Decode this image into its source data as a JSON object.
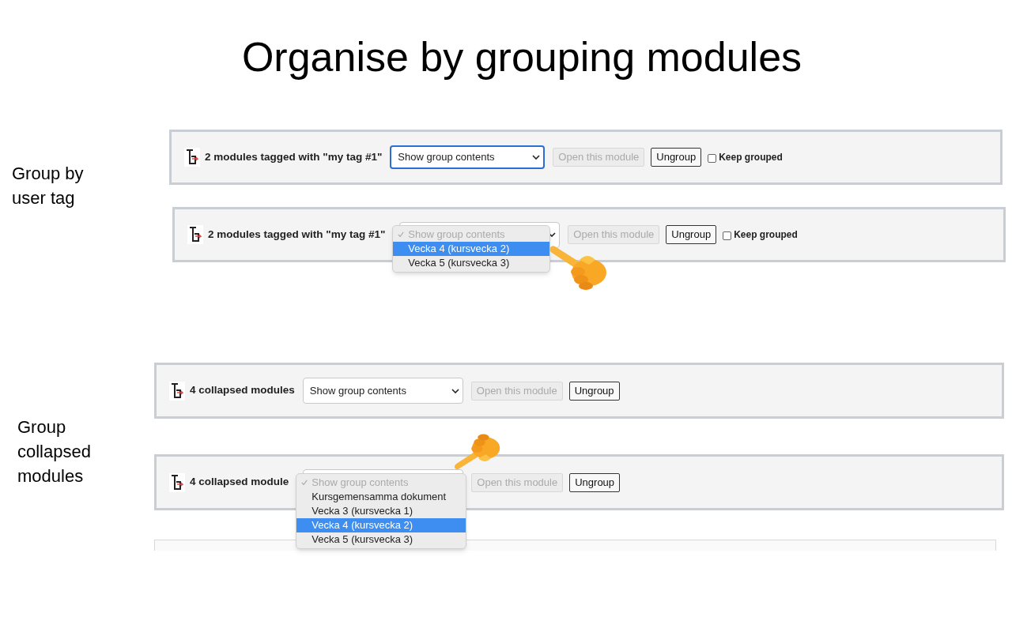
{
  "title": "Organise by grouping modules",
  "sections": [
    {
      "label": "Group by user tag",
      "panels": [
        {
          "heading": "2 modules tagged with \"my tag #1\"",
          "select": {
            "value": "Show group contents",
            "focused": true,
            "open": false
          },
          "open_button": {
            "label": "Open this module",
            "disabled": true
          },
          "ungroup_button": "Ungroup",
          "keep_grouped": {
            "label": "Keep grouped",
            "checked": false
          }
        },
        {
          "heading": "2 modules tagged with \"my tag #1\"",
          "select": {
            "focused": false,
            "open": true,
            "options": [
              {
                "label": "Show group contents",
                "disabled": true,
                "checked": true,
                "selected": false
              },
              {
                "label": "Vecka 4 (kursvecka 2)",
                "disabled": false,
                "checked": false,
                "selected": true
              },
              {
                "label": "Vecka 5 (kursvecka 3)",
                "disabled": false,
                "checked": false,
                "selected": false
              }
            ]
          },
          "open_button": {
            "label": "Open this module",
            "disabled": true
          },
          "ungroup_button": "Ungroup",
          "keep_grouped": {
            "label": "Keep grouped",
            "checked": false
          }
        }
      ]
    },
    {
      "label": "Group collapsed modules",
      "panels": [
        {
          "heading": "4 collapsed modules",
          "select": {
            "value": "Show group contents",
            "focused": false,
            "open": false
          },
          "open_button": {
            "label": "Open this module",
            "disabled": true
          },
          "ungroup_button": "Ungroup"
        },
        {
          "heading": "4 collapsed module",
          "select": {
            "focused": false,
            "open": true,
            "options": [
              {
                "label": "Show group contents",
                "disabled": true,
                "checked": true,
                "selected": false
              },
              {
                "label": "Kursgemensamma dokument",
                "disabled": false,
                "checked": false,
                "selected": false
              },
              {
                "label": "Vecka 3 (kursvecka 1)",
                "disabled": false,
                "checked": false,
                "selected": false
              },
              {
                "label": "Vecka 4 (kursvecka 2)",
                "disabled": false,
                "checked": false,
                "selected": true
              },
              {
                "label": "Vecka 5 (kursvecka 3)",
                "disabled": false,
                "checked": false,
                "selected": false
              }
            ]
          },
          "open_button": {
            "label": "Open this module",
            "disabled": true
          },
          "ungroup_button": "Ungroup"
        }
      ]
    }
  ]
}
